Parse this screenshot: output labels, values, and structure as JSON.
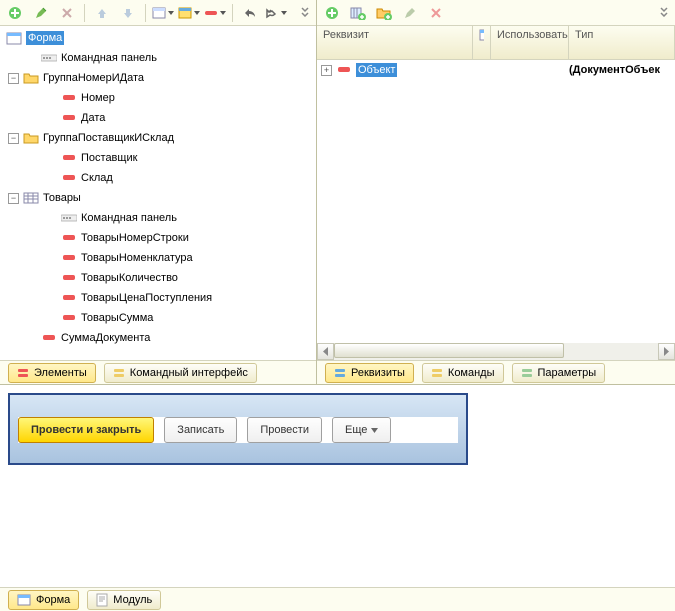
{
  "leftTree": {
    "root": "Форма",
    "nodes": [
      {
        "ind": 26,
        "exp": "",
        "ico": "cmdpanel",
        "label": "Командная панель"
      },
      {
        "ind": 8,
        "exp": "-",
        "ico": "folder",
        "label": "ГруппаНомерИДата"
      },
      {
        "ind": 46,
        "exp": "",
        "ico": "bar",
        "label": "Номер"
      },
      {
        "ind": 46,
        "exp": "",
        "ico": "bar",
        "label": "Дата"
      },
      {
        "ind": 8,
        "exp": "-",
        "ico": "folder",
        "label": "ГруппаПоставщикИСклад"
      },
      {
        "ind": 46,
        "exp": "",
        "ico": "bar",
        "label": "Поставщик"
      },
      {
        "ind": 46,
        "exp": "",
        "ico": "bar",
        "label": "Склад"
      },
      {
        "ind": 8,
        "exp": "-",
        "ico": "table",
        "label": "Товары"
      },
      {
        "ind": 46,
        "exp": "",
        "ico": "cmdpanel",
        "label": "Командная панель"
      },
      {
        "ind": 46,
        "exp": "",
        "ico": "bar",
        "label": "ТоварыНомерСтроки"
      },
      {
        "ind": 46,
        "exp": "",
        "ico": "bar",
        "label": "ТоварыНоменклатура"
      },
      {
        "ind": 46,
        "exp": "",
        "ico": "bar",
        "label": "ТоварыКоличество"
      },
      {
        "ind": 46,
        "exp": "",
        "ico": "bar",
        "label": "ТоварыЦенаПоступления"
      },
      {
        "ind": 46,
        "exp": "",
        "ico": "bar",
        "label": "ТоварыСумма"
      },
      {
        "ind": 26,
        "exp": "",
        "ico": "bar",
        "label": "СуммаДокумента"
      }
    ]
  },
  "leftBottomTabs": {
    "t1": "Элементы",
    "t2": "Командный интерфейс"
  },
  "rightGrid": {
    "headers": {
      "c1": "Реквизит",
      "c3": "Использовать",
      "c4": "Тип"
    },
    "row": {
      "label": "Объект",
      "type": "(ДокументОбъек"
    }
  },
  "rightBottomTabs": {
    "t1": "Реквизиты",
    "t2": "Команды",
    "t3": "Параметры"
  },
  "preview": {
    "b1": "Провести и закрыть",
    "b2": "Записать",
    "b3": "Провести",
    "b4": "Еще"
  },
  "rootTabs": {
    "t1": "Форма",
    "t2": "Модуль"
  }
}
